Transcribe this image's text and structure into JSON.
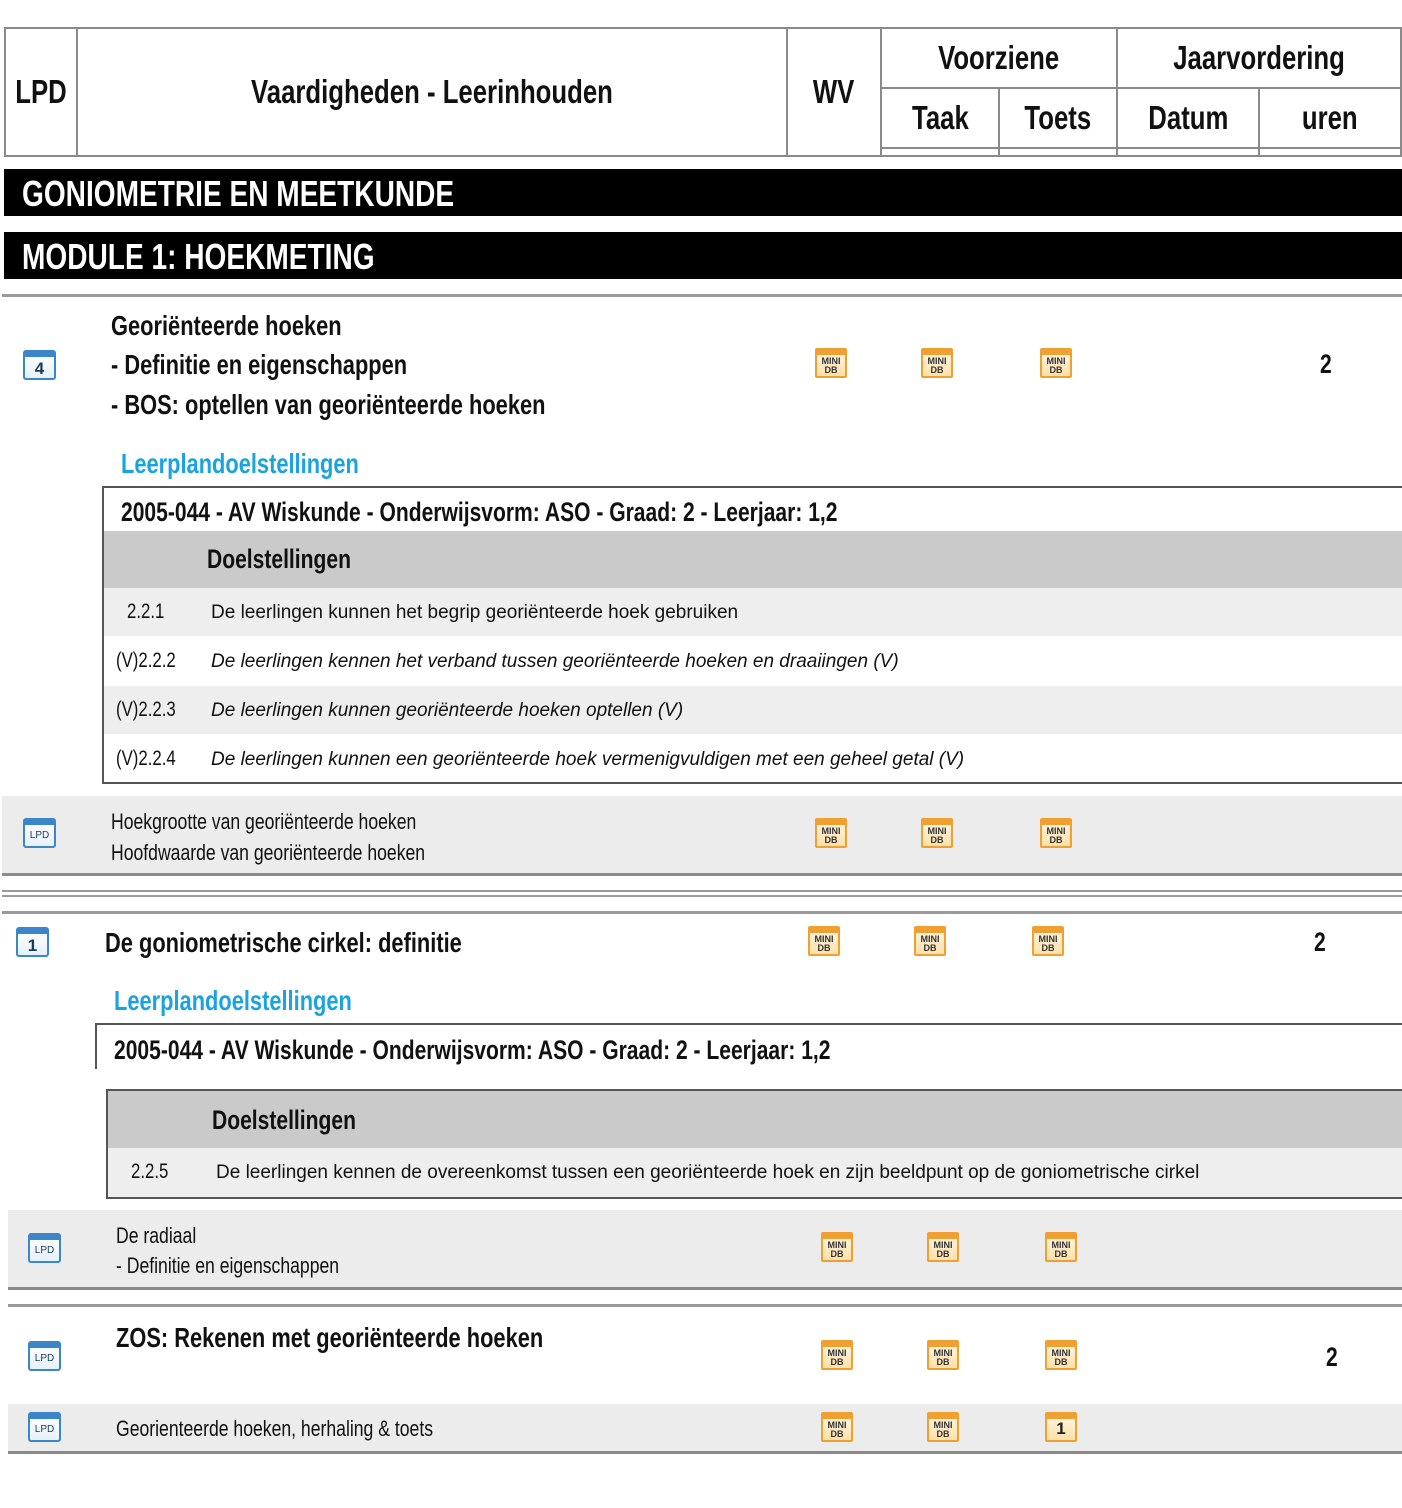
{
  "header": {
    "lpd": "LPD",
    "skills": "Vaardigheden - Leerinhouden",
    "wv": "WV",
    "voorziene": "Voorziene",
    "jaarvordering": "Jaarvordering",
    "taak": "Taak",
    "toets": "Toets",
    "datum": "Datum",
    "uren": "uren"
  },
  "sections": {
    "domain": "GONIOMETRIE EN MEETKUNDE",
    "module": "MODULE 1: HOEKMETING"
  },
  "icons": {
    "lesson_one": "4",
    "lesson_two": "1",
    "lpd": "LPD",
    "mini_db": "MINI DB",
    "toets_one": "1"
  },
  "lessons": [
    {
      "lines": [
        "Georiënteerde hoeken",
        "- Definitie en eigenschappen",
        "- BOS: optellen van georiënteerde hoeken"
      ],
      "hours": "2",
      "leerplan_label": "Leerplandoelstellingen",
      "leerplan": "2005-044 - AV Wiskunde - Onderwijsvorm: ASO - Graad: 2 - Leerjaar: 1,2",
      "doel_header": "Doelstellingen",
      "objectives": [
        {
          "code": "2.2.1",
          "text": "De leerlingen kunnen het begrip georiënteerde hoek gebruiken"
        },
        {
          "code": "(V)2.2.2",
          "text": "De leerlingen kennen het verband tussen georiënteerde hoeken en draaiingen (V)"
        },
        {
          "code": "(V)2.2.3",
          "text": "De leerlingen kunnen georiënteerde hoeken optellen (V)"
        },
        {
          "code": "(V)2.2.4",
          "text": "De leerlingen kunnen een georiënteerde hoek vermenigvuldigen met een geheel getal (V)"
        }
      ],
      "sub": [
        "Hoekgrootte van georiënteerde hoeken",
        "Hoofdwaarde van georiënteerde hoeken"
      ]
    },
    {
      "lines": [
        "De goniometrische cirkel: definitie"
      ],
      "hours": "2",
      "leerplan_label": "Leerplandoelstellingen",
      "leerplan": "2005-044 - AV Wiskunde - Onderwijsvorm: ASO - Graad: 2 - Leerjaar: 1,2",
      "doel_header": "Doelstellingen",
      "objectives": [
        {
          "code": "2.2.5",
          "text": "De leerlingen kennen de overeenkomst tussen een georiënteerde hoek en zijn beeldpunt op de goniometrische cirkel"
        }
      ],
      "sub": [
        "De radiaal",
        "- Definitie en eigenschappen"
      ]
    },
    {
      "lines": [
        "ZOS: Rekenen met georiënteerde hoeken"
      ],
      "hours": "2",
      "sub": [
        "Georienteerde hoeken, herhaling & toets"
      ]
    }
  ]
}
